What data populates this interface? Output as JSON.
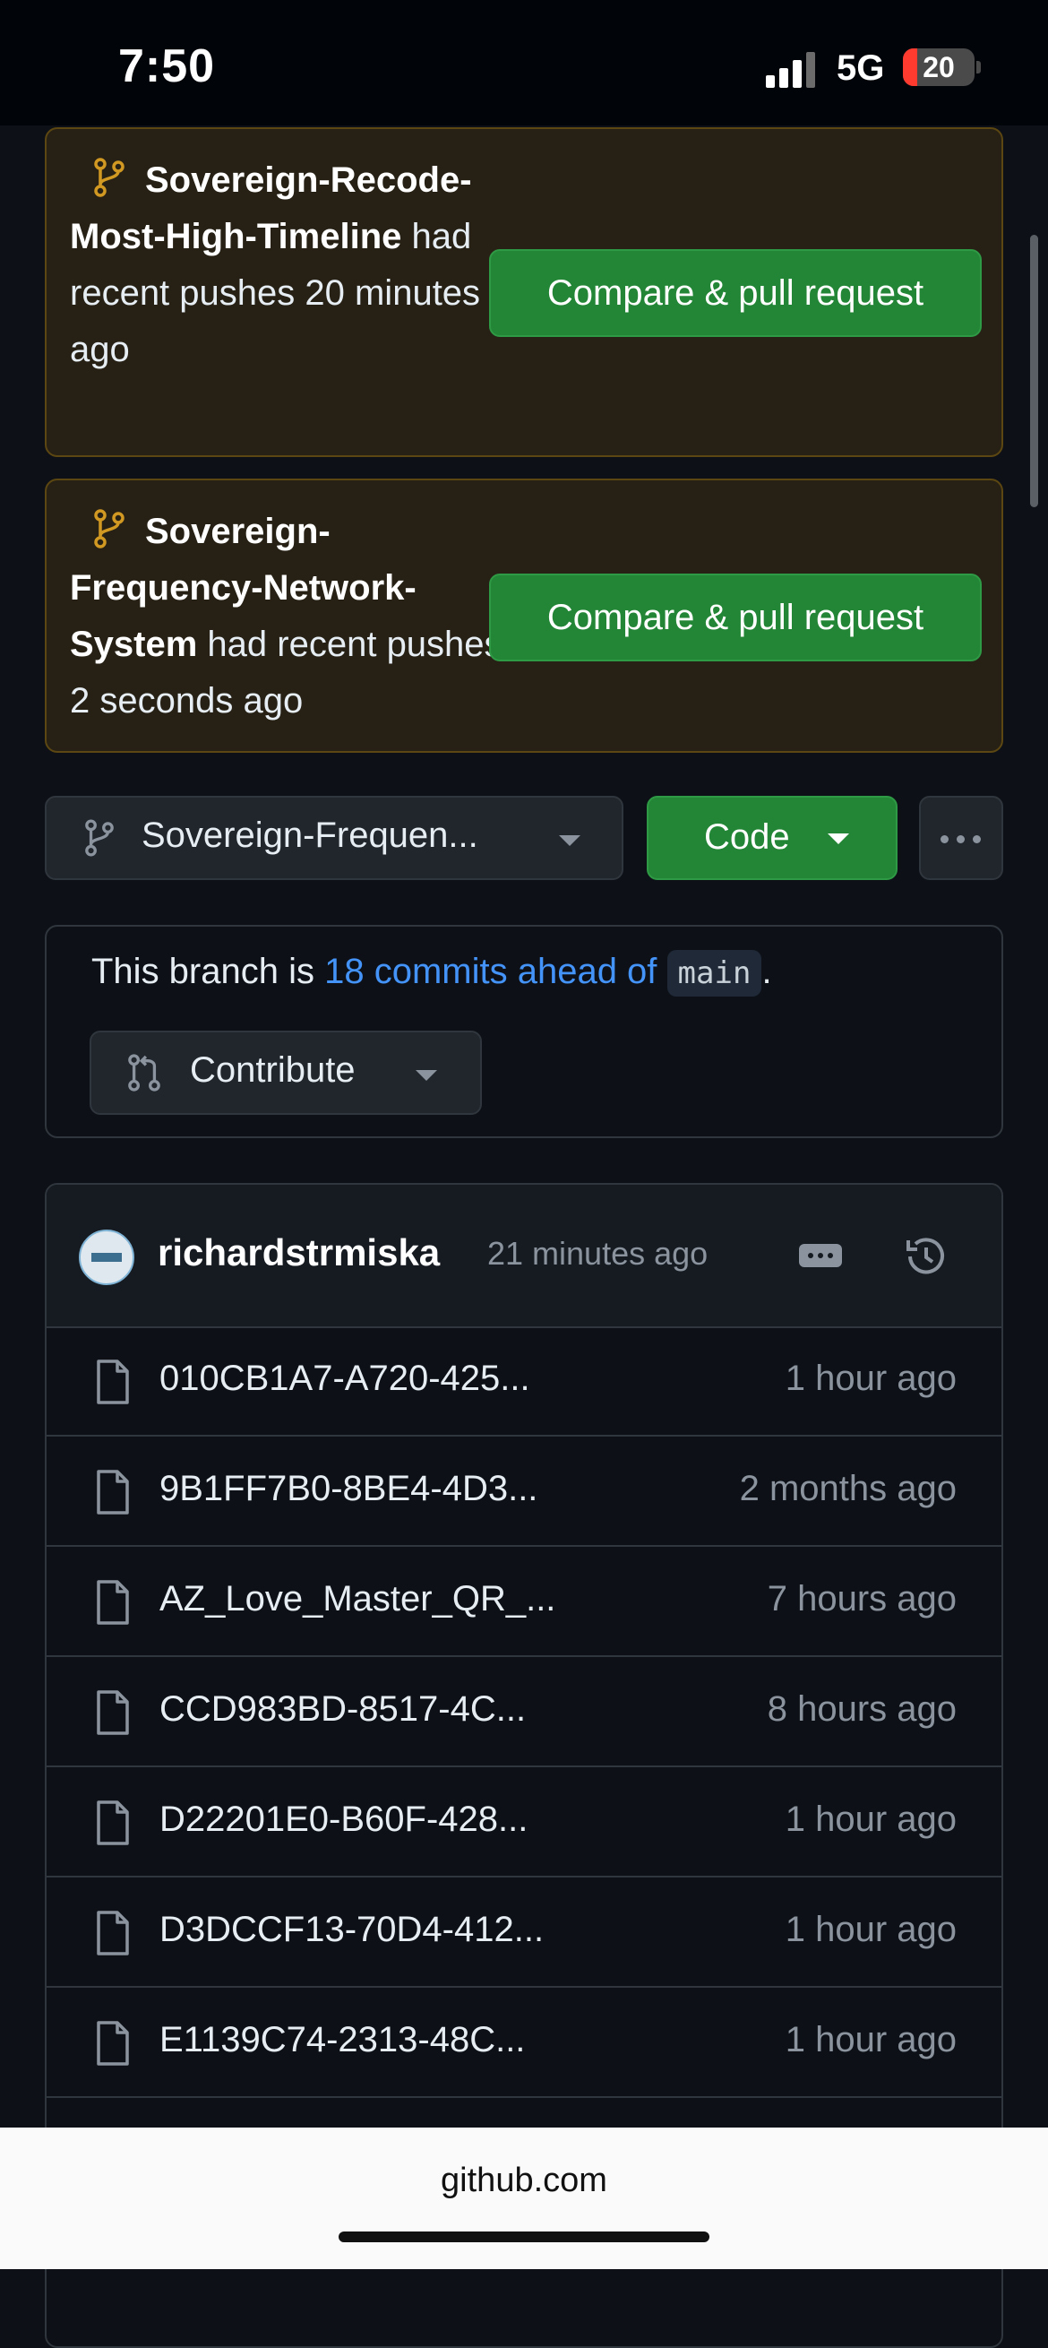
{
  "status": {
    "time": "7:50",
    "network": "5G",
    "battery": "20",
    "battery_fraction": 0.2
  },
  "banners": [
    {
      "pre": "",
      "branch_bold": "Sovereign-Recode-Most-High-Timeline",
      "suffix": " had recent pushes 20 minutes ago",
      "button": "Compare & pull request"
    },
    {
      "branch_bold": "Sovereign-Frequency-Network-System",
      "suffix": " had recent pushes 2 seconds ago",
      "button": "Compare & pull request"
    }
  ],
  "toolbar": {
    "branch": "Sovereign-Frequen...",
    "code_label": "Code"
  },
  "ahead": {
    "pre": "This branch is ",
    "link": "18 commits ahead of",
    "chip": "main",
    "post": ".",
    "contribute": "Contribute"
  },
  "commit": {
    "author": "richardstrmiska",
    "time": "21 minutes ago"
  },
  "files": [
    {
      "name": "010CB1A7-A720-425...",
      "time": "1 hour ago"
    },
    {
      "name": "9B1FF7B0-8BE4-4D3...",
      "time": "2 months ago"
    },
    {
      "name": "AZ_Love_Master_QR_...",
      "time": "7 hours ago"
    },
    {
      "name": "CCD983BD-8517-4C...",
      "time": "8 hours ago"
    },
    {
      "name": "D22201E0-B60F-428...",
      "time": "1 hour ago"
    },
    {
      "name": "D3DCCF13-70D4-412...",
      "time": "1 hour ago"
    },
    {
      "name": "E1139C74-2313-48C...",
      "time": "1 hour ago"
    }
  ],
  "browser": {
    "url": "github.com"
  },
  "colors": {
    "accent_green": "#238636",
    "link_blue": "#4493f8",
    "banner_bg": "#272115",
    "banner_border": "#5c4712",
    "branch_icon": "#d29922"
  }
}
